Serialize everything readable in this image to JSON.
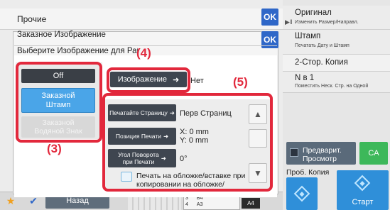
{
  "background": {
    "title": "Прочие",
    "ok_label": "OK"
  },
  "right_panel": {
    "items": [
      {
        "title": "Оригинал",
        "subtitle": "Изменить Размер/Направл."
      },
      {
        "title": "Штамп",
        "subtitle": "Печатать Дату и Штамп"
      },
      {
        "title": "2-Стор. Копия",
        "subtitle": ""
      },
      {
        "title": "N в 1",
        "subtitle": "Поместить Неск. Стр. на Одной"
      }
    ],
    "preview_label_1": "Предварит.",
    "preview_label_2": "Просмотр",
    "ca_label": "CA",
    "proof_label": "Проб. Копия",
    "start_label": "Старт"
  },
  "bottom_bar": {
    "back_label": "Назад",
    "tray_rows": [
      {
        "num": "3",
        "size": "B4"
      },
      {
        "num": "4",
        "size": "A3"
      }
    ],
    "paper_size": "A4"
  },
  "dialog1": {
    "title": "Заказное Изображение",
    "ok_label": "OK"
  },
  "dialog2": {
    "title": "Выберите Изображение для Рабо",
    "options": {
      "off": "Off",
      "stamp_line1": "Заказной",
      "stamp_line2": "Штамп",
      "watermark_line1": "Заказной",
      "watermark_line2": "Водяной Знак"
    },
    "image_button": "Изображение",
    "set_text": "Нет",
    "settings": {
      "print_page_label": "Печатайте Страницу",
      "print_page_value": "Перв Страниц",
      "print_pos_label": "Позиция Печати",
      "pos_x": "X: 0 mm",
      "pos_y": "Y: 0 mm",
      "rotate_line1": "Угол Поворота",
      "rotate_line2": "при Печати",
      "rotate_value": "0°",
      "checkbox_label": "Печать на обложке/вставке при копировании на обложке/вставке"
    }
  },
  "annotations": {
    "label_3": "(3)",
    "label_4": "(4)",
    "label_5": "(5)"
  },
  "colors": {
    "accent_blue": "#2f67c8",
    "annotation_red": "#e2283c",
    "selected_option": "#4aa5e8",
    "ca_green": "#3db85a"
  }
}
